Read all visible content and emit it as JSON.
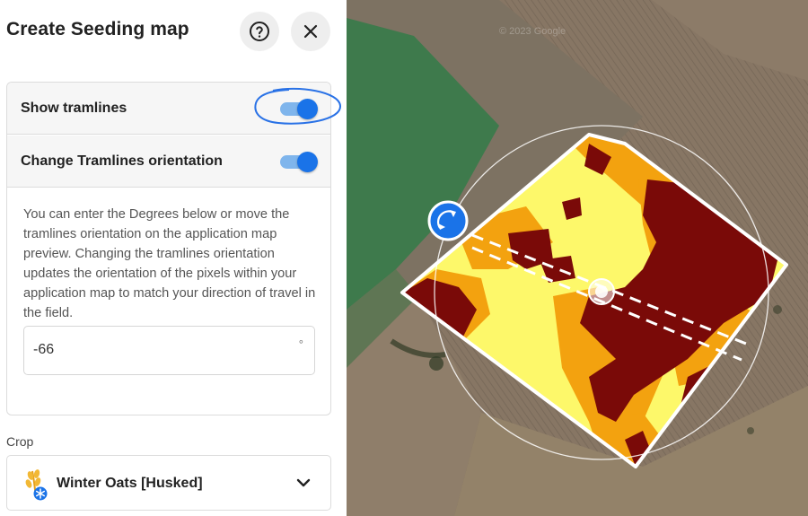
{
  "panel": {
    "title": "Create Seeding map",
    "help_icon": "help-circle-icon",
    "close_icon": "close-icon"
  },
  "tramlines": {
    "show_label": "Show tramlines",
    "show_enabled": true,
    "orientation_label": "Change Tramlines orientation",
    "orientation_enabled": true,
    "description": "You can enter the Degrees below or move the tramlines orientation on the application map preview. Changing the tramlines orientation updates the orientation of the pixels within your application map to match your direction of travel in the field.",
    "degrees_value": "-66",
    "degrees_unit": "°"
  },
  "crop": {
    "label": "Crop",
    "selected": "Winter Oats [Husked]",
    "icon": "winter-oats-icon"
  },
  "map": {
    "watermark": "© 2023 Google",
    "rotate_icon": "rotate-icon",
    "colors": {
      "high": "#7a0a08",
      "medium": "#f3a20f",
      "low": "#fdf86a",
      "accent": "#1a73e8"
    }
  }
}
